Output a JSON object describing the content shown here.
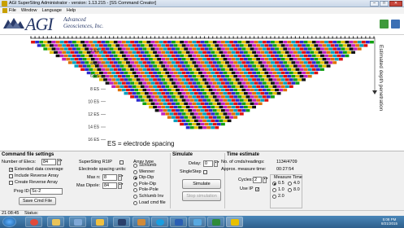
{
  "window": {
    "title": "AGI SuperSting Administrator - version: 1.13.215 - [SS Command Creator]",
    "min_icon": "minimize-icon",
    "max_icon": "maximize-icon",
    "close_icon": "close-icon"
  },
  "menu": {
    "items": [
      "File",
      "Window",
      "Language",
      "Help"
    ]
  },
  "brand": {
    "logo_text": "AGI",
    "logo_sub1": "Advanced",
    "logo_sub2": "Geosciences, Inc."
  },
  "plot": {
    "depth_labels": [
      "2 ES",
      "4 ES",
      "6 ES",
      "8 ES",
      "10 ES",
      "12 ES",
      "14 ES",
      "16 ES"
    ],
    "legend": "ES = electrode spacing",
    "side_label": "Estimated depth penetration",
    "electrode_count": 84,
    "colors": [
      "#e01010",
      "#2a2ad0",
      "#10a010",
      "#e0c000",
      "#111111",
      "#c020c0",
      "#e07000",
      "#00a0c0"
    ]
  },
  "command_settings": {
    "title": "Command file settings",
    "num_elecs_label": "Number of Elecs:",
    "num_elecs_value": "84",
    "extended_label": "Extended data coverage",
    "extended_checked": true,
    "include_reverse_label": "Include Reverse Array",
    "create_reverse_label": "Create Reverse Array",
    "prog_id_label": "Prog ID:",
    "prog_id_value": "Sc-2",
    "save_button": "Save Cmd File",
    "r1ip_label": "SuperSting R1IP",
    "spacing_label": "Electrode spacing units:",
    "max_n_label": "Max n:",
    "max_n_value": "8",
    "max_dipole_label": "Max Dipole:",
    "max_dipole_value": "84"
  },
  "array_type": {
    "title": "Array type",
    "options": [
      "Schlumb",
      "Wenner",
      "Dip-Dip",
      "Pole-Dip",
      "Pole-Pole",
      "Schlumb Inv",
      "Load cmd file"
    ],
    "selected": "Dip-Dip"
  },
  "simulate": {
    "title": "Simulate",
    "delay_label": "Delay:",
    "delay_value": "0",
    "single_step_label": "SingleStep",
    "simulate_button": "Simulate",
    "stop_button": "Stop simulation"
  },
  "time_estimate": {
    "title": "Time estimate",
    "readings_label": "No. of cmds/readings:",
    "readings_value": "1134/4709",
    "measure_time_label": "Approx. measure time:",
    "measure_time_value": "00:27:54",
    "cycles_label": "Cycles:",
    "cycles_value": "2",
    "use_ip_label": "Use IP",
    "group_title": "Measure Time",
    "options": [
      "0.5",
      "1.0",
      "2.0",
      "4.0",
      "8.0"
    ],
    "selected": "0.5"
  },
  "status": {
    "time": "21:08:45",
    "label": "Status:"
  },
  "taskbar": {
    "clock_time": "5:08 PM",
    "clock_date": "8/21/2015"
  }
}
